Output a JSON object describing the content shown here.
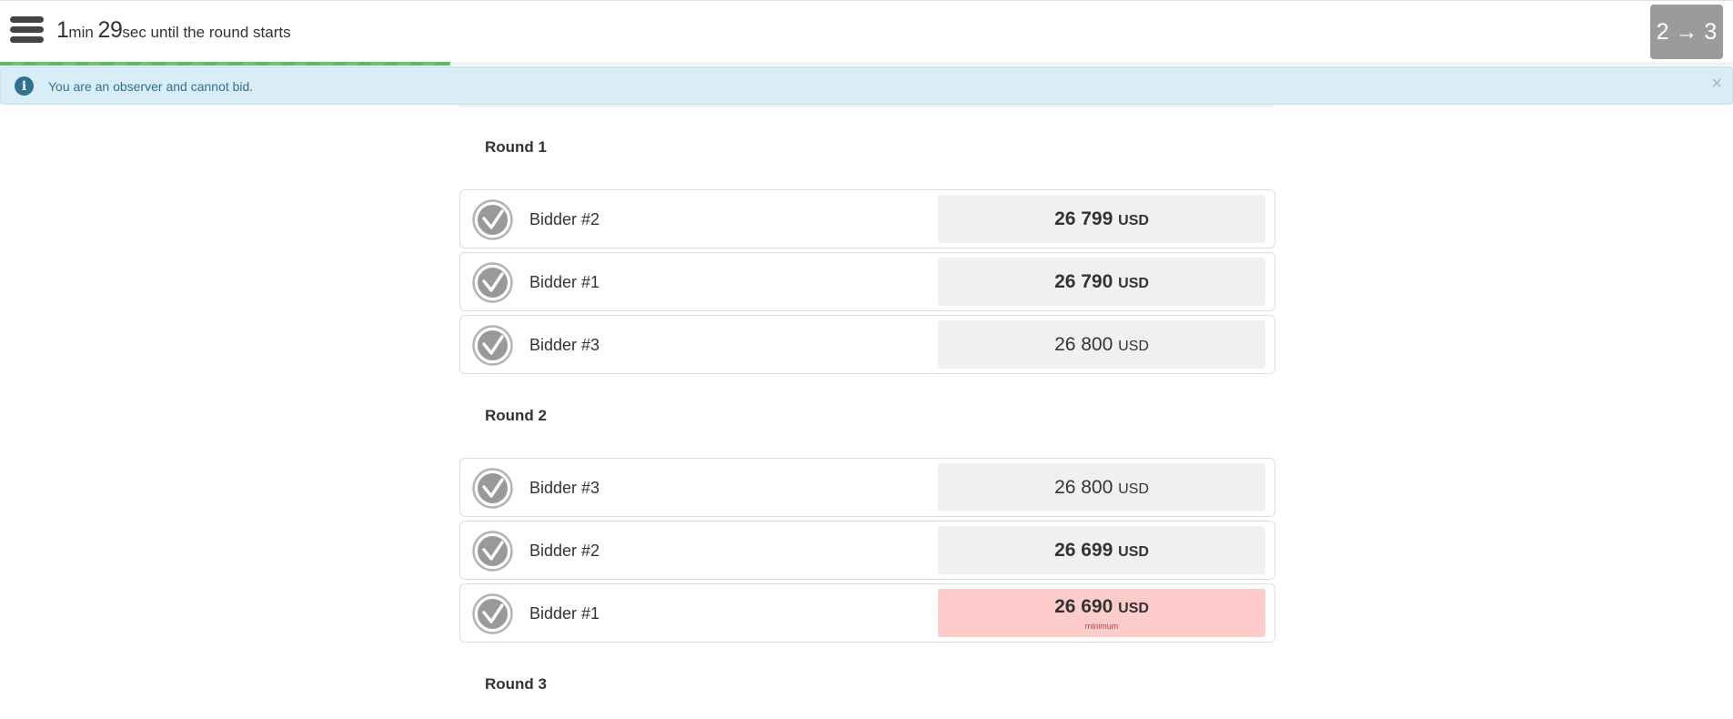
{
  "header": {
    "timer_minutes": "1",
    "timer_minutes_unit": "min",
    "timer_seconds": "29",
    "timer_seconds_unit": "sec",
    "timer_suffix": " until the round starts",
    "round_badge": "2 → 3",
    "progress_fraction": 0.26
  },
  "alert": {
    "text": "You are an observer and cannot bid.",
    "info_icon_glyph": "i",
    "close_glyph": "×",
    "color": "#31708f"
  },
  "rounds": [
    {
      "title": "Round 1",
      "bids": [
        {
          "bidder": "Bidder #2",
          "amount": "26 799",
          "currency": "USD",
          "emphasis": true,
          "minimum": false
        },
        {
          "bidder": "Bidder #1",
          "amount": "26 790",
          "currency": "USD",
          "emphasis": true,
          "minimum": false
        },
        {
          "bidder": "Bidder #3",
          "amount": "26 800",
          "currency": "USD",
          "emphasis": false,
          "minimum": false
        }
      ]
    },
    {
      "title": "Round 2",
      "bids": [
        {
          "bidder": "Bidder #3",
          "amount": "26 800",
          "currency": "USD",
          "emphasis": false,
          "minimum": false
        },
        {
          "bidder": "Bidder #2",
          "amount": "26 699",
          "currency": "USD",
          "emphasis": true,
          "minimum": false
        },
        {
          "bidder": "Bidder #1",
          "amount": "26 690",
          "currency": "USD",
          "emphasis": true,
          "minimum": true,
          "minimum_label": "minimum"
        }
      ]
    },
    {
      "title": "Round 3",
      "bids": []
    }
  ],
  "colors": {
    "progress": "#5cb85c",
    "alert_bg": "#d9edf7",
    "minimum_bg": "#ffcccc",
    "bid_bg": "#f0f0f0",
    "badge_bg": "#9b9b9b"
  }
}
